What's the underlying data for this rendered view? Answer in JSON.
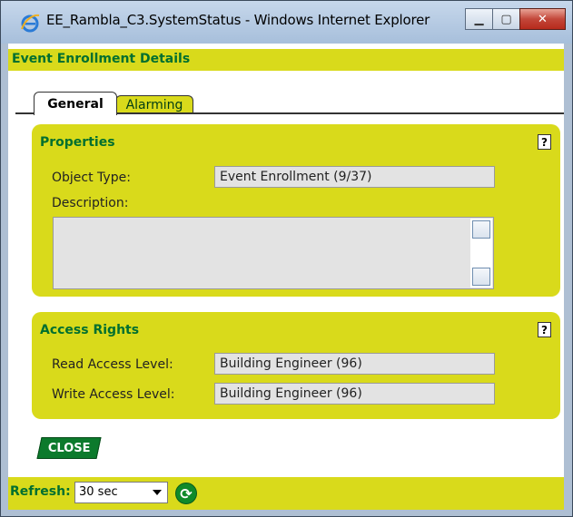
{
  "window": {
    "title": "EE_Rambla_C3.SystemStatus - Windows Internet Explorer"
  },
  "header": {
    "title": "Event Enrollment Details"
  },
  "tabs": [
    {
      "label": "General",
      "selected": true
    },
    {
      "label": "Alarming",
      "selected": false
    }
  ],
  "properties": {
    "title": "Properties",
    "help": "?",
    "object_type_label": "Object Type:",
    "object_type_value": "Event Enrollment (9/37)",
    "description_label": "Description:",
    "description_value": ""
  },
  "access": {
    "title": "Access Rights",
    "help": "?",
    "read_label": "Read Access Level:",
    "read_value": "Building Engineer (96)",
    "write_label": "Write Access Level:",
    "write_value": "Building Engineer (96)"
  },
  "close_label": "CLOSE",
  "footer": {
    "refresh_label": "Refresh:",
    "refresh_value": "30 sec"
  },
  "colors": {
    "accent": "#d9da1b",
    "brand_green": "#006f2f"
  },
  "icons": [
    "ie-icon",
    "minimize-icon",
    "maximize-icon",
    "close-icon",
    "help-icon",
    "refresh-icon"
  ]
}
